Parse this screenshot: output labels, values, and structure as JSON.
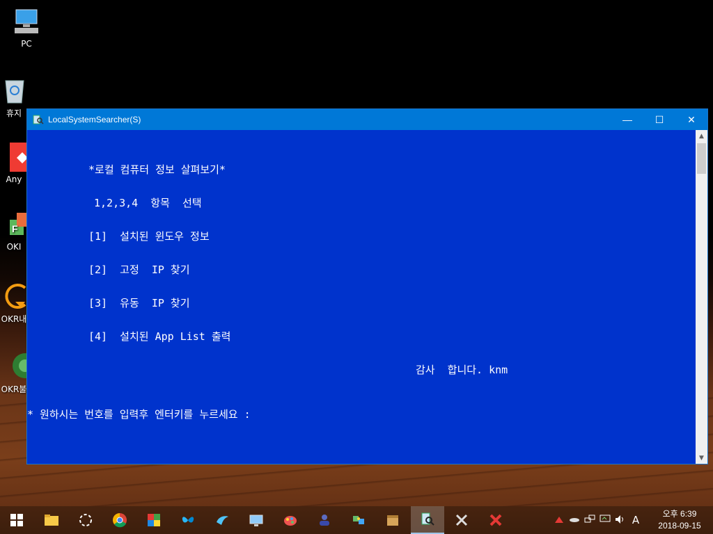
{
  "desktop": {
    "icons": [
      {
        "label": "PC",
        "icon": "computer-icon"
      },
      {
        "label": "휴지",
        "icon": "recycle-bin-icon"
      },
      {
        "label": "Any",
        "icon": "anydesk-icon"
      },
      {
        "label": "OKI",
        "icon": "okr-app-icon"
      },
      {
        "label": "OKR내",
        "icon": "refresh-arrow-icon"
      },
      {
        "label": "OKR불",
        "icon": "green-disc-icon"
      }
    ]
  },
  "window": {
    "title": "LocalSystemSearcher(S)",
    "controls": {
      "minimize": "—",
      "maximize": "☐",
      "close": "✕"
    }
  },
  "console": {
    "heading": "*로컬 컴퓨터 정보 살펴보기*",
    "prompt_select": "1,2,3,4  항목  선택",
    "options": [
      "[1]  설치된 윈도우 정보",
      "[2]  고정  IP 찾기",
      "[3]  유동  IP 찾기",
      "[4]  설치된 App List 출력"
    ],
    "thanks": "감사  합니다. knm",
    "input_prompt": "* 원하시는 번호를 입력후 엔터키를 누르세요 :"
  },
  "taskbar": {
    "apps": [
      "start-icon",
      "file-explorer-icon",
      "capture-icon",
      "chrome-icon",
      "colorful-app-icon",
      "butterfly-icon",
      "bird-icon",
      "monitor-icon",
      "paint-icon",
      "network-user-icon",
      "puzzle-icon",
      "box-icon",
      "local-system-searcher-icon",
      "tools-icon",
      "red-x-icon"
    ],
    "ime": "A",
    "clock_ampm_time": "오후 6:39",
    "clock_date": "2018-09-15"
  }
}
